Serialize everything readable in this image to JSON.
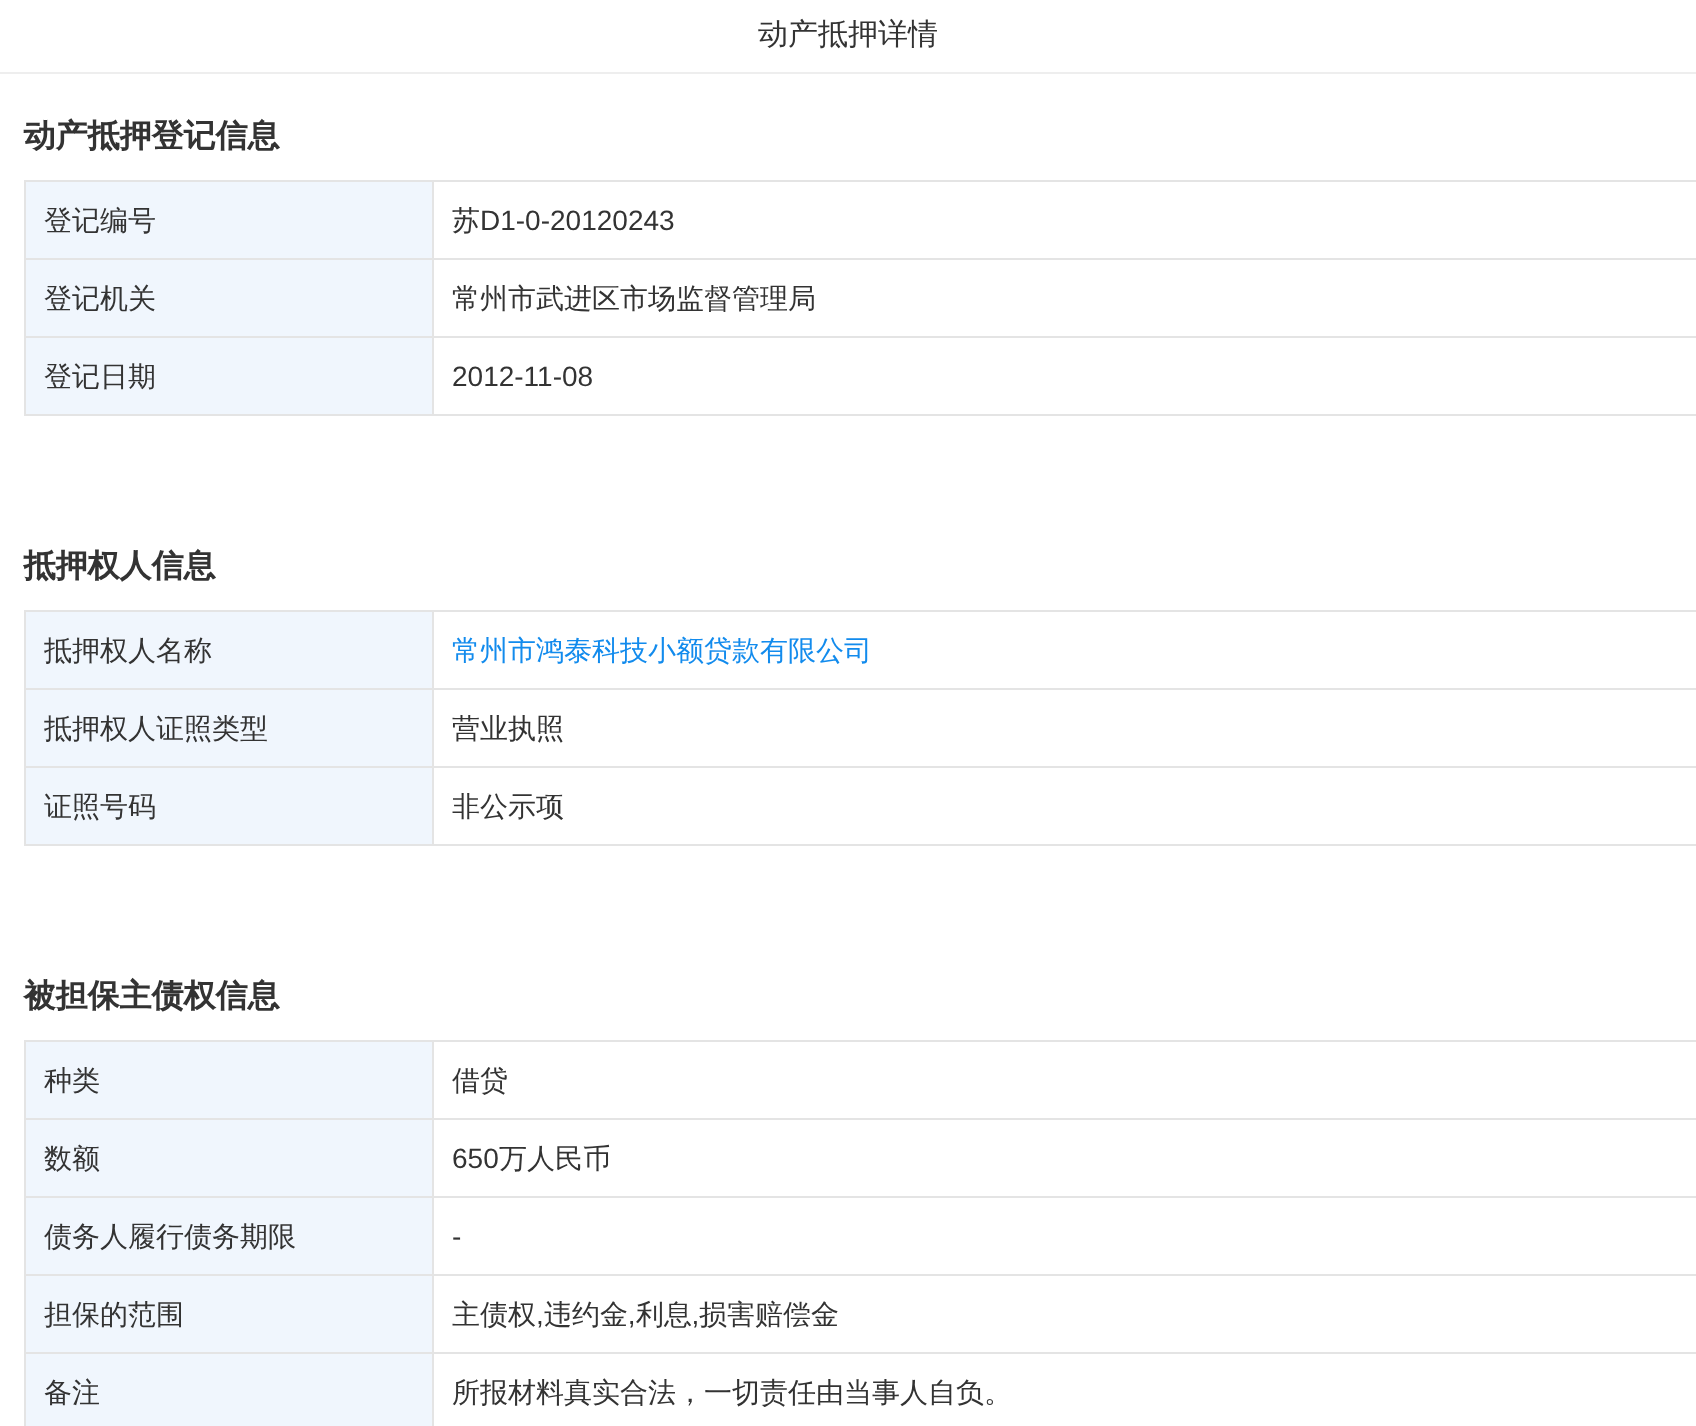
{
  "title": "动产抵押详情",
  "sections": [
    {
      "heading": "动产抵押登记信息",
      "rows": [
        {
          "label": "登记编号",
          "value": "苏D1-0-20120243",
          "kind": "text"
        },
        {
          "label": "登记机关",
          "value": "常州市武进区市场监督管理局",
          "kind": "text"
        },
        {
          "label": "登记日期",
          "value": "2012-11-08",
          "kind": "text"
        }
      ]
    },
    {
      "heading": "抵押权人信息",
      "rows": [
        {
          "label": "抵押权人名称",
          "value": "常州市鸿泰科技小额贷款有限公司",
          "kind": "link"
        },
        {
          "label": "抵押权人证照类型",
          "value": "营业执照",
          "kind": "text"
        },
        {
          "label": "证照号码",
          "value": "非公示项",
          "kind": "text"
        }
      ]
    },
    {
      "heading": "被担保主债权信息",
      "rows": [
        {
          "label": "种类",
          "value": "借贷",
          "kind": "text"
        },
        {
          "label": "数额",
          "value": "650万人民币",
          "kind": "text"
        },
        {
          "label": "债务人履行债务期限",
          "value": "-",
          "kind": "text"
        },
        {
          "label": "担保的范围",
          "value": "主债权,违约金,利息,损害赔偿金",
          "kind": "text"
        },
        {
          "label": "备注",
          "value": "所报材料真实合法，一切责任由当事人自负。",
          "kind": "text"
        }
      ]
    }
  ]
}
